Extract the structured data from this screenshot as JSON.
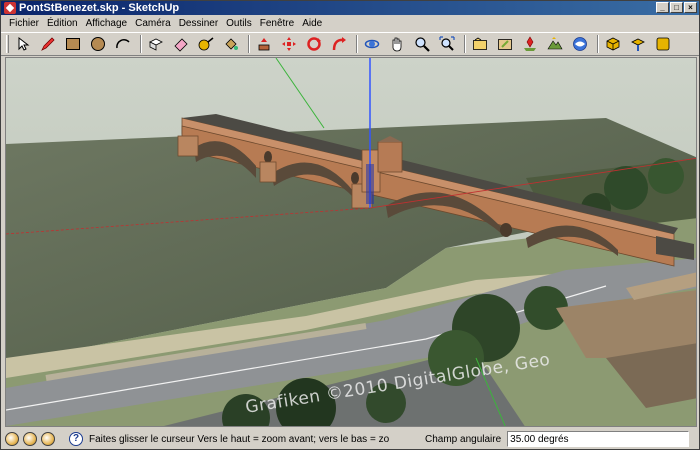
{
  "window": {
    "title": "PontStBenezet.skp - SketchUp",
    "buttons": {
      "minimize": "_",
      "maximize": "□",
      "close": "×"
    }
  },
  "menu": {
    "items": [
      "Fichier",
      "Édition",
      "Affichage",
      "Caméra",
      "Dessiner",
      "Outils",
      "Fenêtre",
      "Aide"
    ]
  },
  "toolbar": {
    "tools": [
      "select-icon",
      "pencil-icon",
      "rectangle-icon",
      "circle-icon",
      "arc-icon",
      "make-component-icon",
      "eraser-icon",
      "tape-measure-icon",
      "paint-bucket-icon",
      "push-pull-icon",
      "move-icon",
      "rotate-icon",
      "follow-me-icon",
      "orbit-icon",
      "pan-icon",
      "zoom-icon",
      "zoom-extents-icon",
      "get-models-icon",
      "share-model-icon",
      "add-location-icon",
      "toggle-terrain-icon",
      "photo-texture-icon",
      "components-3d-icon",
      "share-component-icon",
      "extension-icon"
    ]
  },
  "viewport": {
    "watermark": "Grafiken ©2010 DigitalGlobe, Geo"
  },
  "status": {
    "hint": "Faites glisser le curseur  Vers le haut = zoom avant; vers le bas = zoom arrière",
    "vcb_label": "Champ angulaire",
    "vcb_value": "35.00 degrés"
  },
  "colors": {
    "titlebar_start": "#0a246a",
    "titlebar_end": "#3a6ea5",
    "chrome": "#d4d0c8",
    "bridge": "#c8906a",
    "river": "#5c6752"
  }
}
